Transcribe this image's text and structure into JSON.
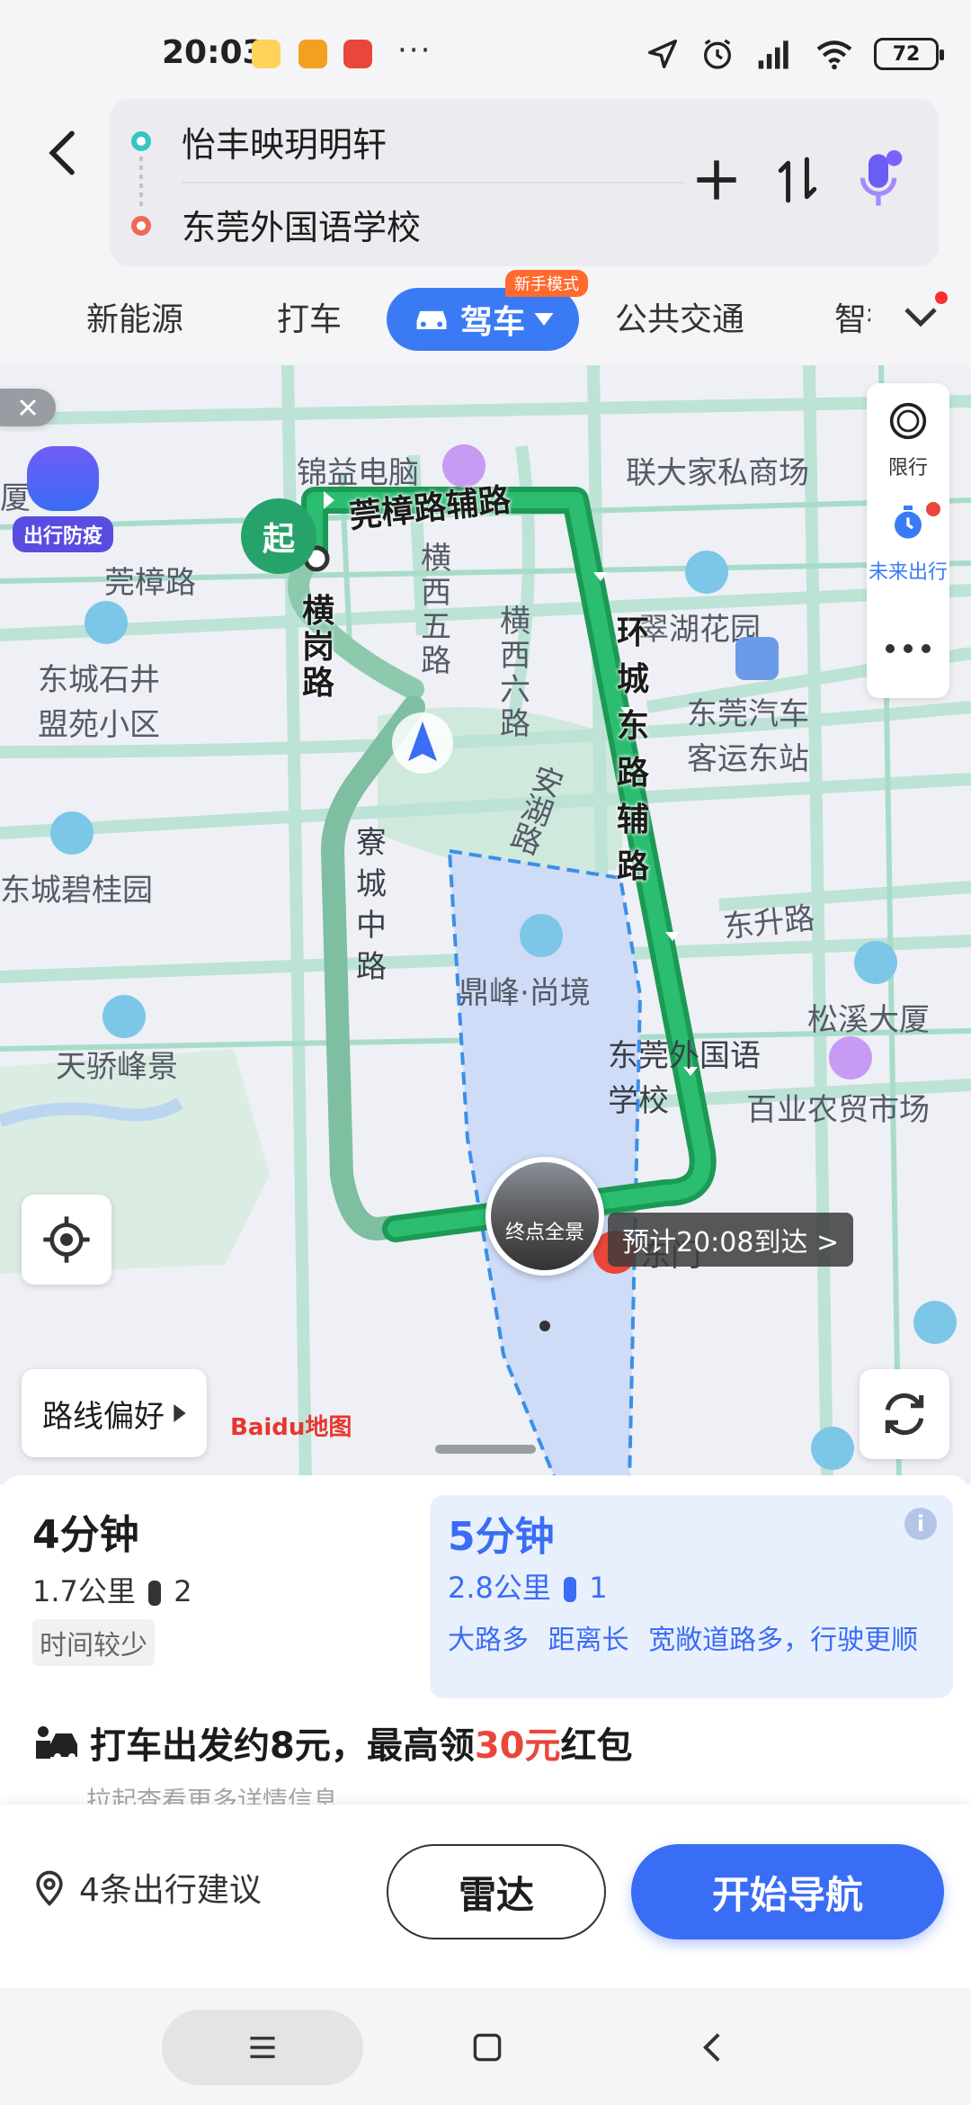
{
  "status_bar": {
    "time": "20:03",
    "more": "···",
    "battery": "72"
  },
  "route": {
    "origin": "怡丰映玥明轩",
    "destination": "东莞外国语学校"
  },
  "mode_tabs": {
    "items": [
      "新能源",
      "打车",
      "驾车",
      "公共交通",
      "智行"
    ],
    "active": "驾车",
    "badge": "新手模式"
  },
  "map": {
    "labels": {
      "jinyi": "锦益电脑",
      "lianda": "联大家私商场",
      "xiamen_partial": "厦",
      "zhangroad": "莞樟路",
      "wanzhang_fulu": "莞樟路辅路",
      "hengxi5": "横西五路",
      "hengxi6": "横西六路",
      "cuihu": "翠湖花园",
      "dongcheng_shijing": "东城石井",
      "mengyuan": "盟苑小区",
      "keyun1": "东莞汽车",
      "keyun2": "客运东站",
      "anhu": "安湖路",
      "huancheng": "环城东路辅路",
      "dongshengroad": "东升路",
      "biguiyuan": "东城碧桂园",
      "zhaichengzhong": "寮城中路",
      "henglu": "横岗路",
      "dingfeng": "鼎峰·尚境",
      "songxi": "松溪大厦",
      "tianjiao": "天骄峰景",
      "school1": "东莞外国语",
      "school2": "学校",
      "baiye": "百业农贸市场",
      "dongmen": "东门",
      "epidemic": "出行防疫",
      "baidu": "Baidu地图"
    },
    "start_marker": "起",
    "dest_label": "终点全景",
    "eta": "预计20:08到达 >",
    "side_panel": {
      "restrict": "限行",
      "future": "未来出行"
    },
    "route_pref": "路线偏好"
  },
  "options": [
    {
      "time": "4分钟",
      "dist": "1.7公里",
      "lights": "2",
      "tag": "时间较少"
    },
    {
      "time": "5分钟",
      "dist": "2.8公里",
      "lights": "1",
      "tags": [
        "大路多",
        "距离长",
        "宽敞道路多，行驶更顺"
      ]
    }
  ],
  "taxi": {
    "prefix": "打车出发约8元，最高领",
    "amount": "30元",
    "suffix": "红包"
  },
  "pull_hint": "拉起查看更多详情信息",
  "actions": {
    "suggest": "4条出行建议",
    "radar": "雷达",
    "navigate": "开始导航"
  },
  "colors": {
    "primary": "#3a6df5",
    "route_green": "#1faa5a",
    "red_accent": "#e8473a"
  }
}
